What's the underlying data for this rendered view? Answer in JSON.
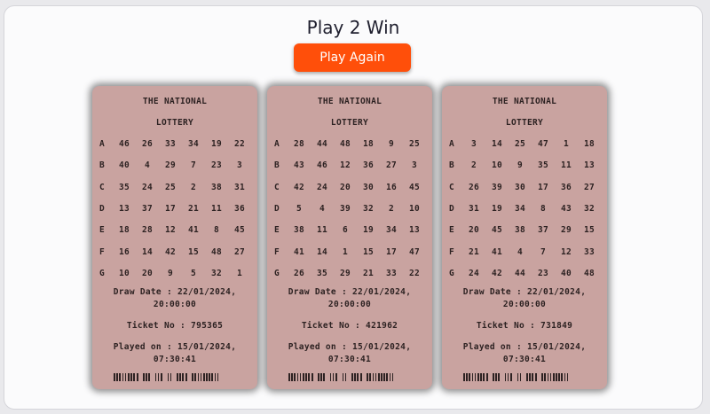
{
  "title": "Play 2 Win",
  "play_button_label": "Play Again",
  "colors": {
    "button": "#ff4f0a",
    "ticket": "#c9a3a0",
    "ink": "#2d2222"
  },
  "tickets": [
    {
      "header1": "THE NATIONAL",
      "header2": "LOTTERY",
      "rows": [
        {
          "letter": "A",
          "numbers": [
            "46",
            "26",
            "33",
            "34",
            "19",
            "22"
          ]
        },
        {
          "letter": "B",
          "numbers": [
            "40",
            "4",
            "29",
            "7",
            "23",
            "3"
          ]
        },
        {
          "letter": "C",
          "numbers": [
            "35",
            "24",
            "25",
            "2",
            "38",
            "31"
          ]
        },
        {
          "letter": "D",
          "numbers": [
            "13",
            "37",
            "17",
            "21",
            "11",
            "36"
          ]
        },
        {
          "letter": "E",
          "numbers": [
            "18",
            "28",
            "12",
            "41",
            "8",
            "45"
          ]
        },
        {
          "letter": "F",
          "numbers": [
            "16",
            "14",
            "42",
            "15",
            "48",
            "27"
          ]
        },
        {
          "letter": "G",
          "numbers": [
            "10",
            "20",
            "9",
            "5",
            "32",
            "1"
          ]
        }
      ],
      "draw_date_line1": "Draw Date : 22/01/2024,",
      "draw_date_line2": "20:00:00",
      "ticket_no": "Ticket No : 795365",
      "played_on_line1": "Played on : 15/01/2024,",
      "played_on_line2": "07:30:41"
    },
    {
      "header1": "THE NATIONAL",
      "header2": "LOTTERY",
      "rows": [
        {
          "letter": "A",
          "numbers": [
            "28",
            "44",
            "48",
            "18",
            "9",
            "25"
          ]
        },
        {
          "letter": "B",
          "numbers": [
            "43",
            "46",
            "12",
            "36",
            "27",
            "3"
          ]
        },
        {
          "letter": "C",
          "numbers": [
            "42",
            "24",
            "20",
            "30",
            "16",
            "45"
          ]
        },
        {
          "letter": "D",
          "numbers": [
            "5",
            "4",
            "39",
            "32",
            "2",
            "10"
          ]
        },
        {
          "letter": "E",
          "numbers": [
            "38",
            "11",
            "6",
            "19",
            "34",
            "13"
          ]
        },
        {
          "letter": "F",
          "numbers": [
            "41",
            "14",
            "1",
            "15",
            "17",
            "47"
          ]
        },
        {
          "letter": "G",
          "numbers": [
            "26",
            "35",
            "29",
            "21",
            "33",
            "22"
          ]
        }
      ],
      "draw_date_line1": "Draw Date : 22/01/2024,",
      "draw_date_line2": "20:00:00",
      "ticket_no": "Ticket No : 421962",
      "played_on_line1": "Played on : 15/01/2024,",
      "played_on_line2": "07:30:41"
    },
    {
      "header1": "THE NATIONAL",
      "header2": "LOTTERY",
      "rows": [
        {
          "letter": "A",
          "numbers": [
            "3",
            "14",
            "25",
            "47",
            "1",
            "18"
          ]
        },
        {
          "letter": "B",
          "numbers": [
            "2",
            "10",
            "9",
            "35",
            "11",
            "13"
          ]
        },
        {
          "letter": "C",
          "numbers": [
            "26",
            "39",
            "30",
            "17",
            "36",
            "27"
          ]
        },
        {
          "letter": "D",
          "numbers": [
            "31",
            "19",
            "34",
            "8",
            "43",
            "32"
          ]
        },
        {
          "letter": "E",
          "numbers": [
            "20",
            "45",
            "38",
            "37",
            "29",
            "15"
          ]
        },
        {
          "letter": "F",
          "numbers": [
            "21",
            "41",
            "4",
            "7",
            "12",
            "33"
          ]
        },
        {
          "letter": "G",
          "numbers": [
            "24",
            "42",
            "44",
            "23",
            "40",
            "48"
          ]
        }
      ],
      "draw_date_line1": "Draw Date : 22/01/2024,",
      "draw_date_line2": "20:00:00",
      "ticket_no": "Ticket No : 731849",
      "played_on_line1": "Played on : 15/01/2024,",
      "played_on_line2": "07:30:41"
    }
  ]
}
